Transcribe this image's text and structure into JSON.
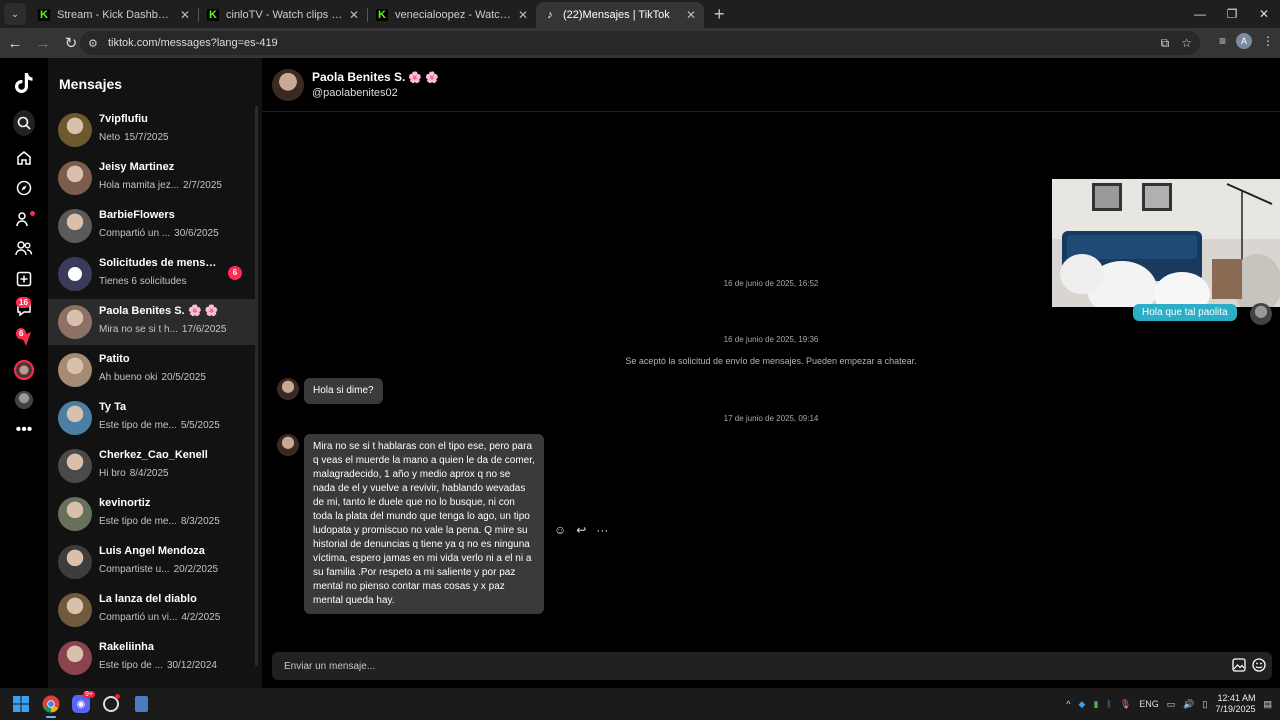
{
  "browser": {
    "tabs": [
      {
        "title": "Stream - Kick Dashboard",
        "favicon": "kick-icon",
        "active": false
      },
      {
        "title": "cinloTV - Watch clips on Kick",
        "favicon": "kick-icon",
        "active": false
      },
      {
        "title": "venecialoopez - Watch clips on",
        "favicon": "kick-icon",
        "active": false
      },
      {
        "title": "(22)Mensajes | TikTok",
        "favicon": "tiktok-icon",
        "active": true
      }
    ],
    "url": "tiktok.com/messages?lang=es-419"
  },
  "rail": {
    "inbox_badge": "16",
    "activity_badge": "6"
  },
  "sidebar": {
    "title": "Mensajes",
    "conversations": [
      {
        "name": "7vipflufiu",
        "preview": "Neto",
        "date": "15/7/2025",
        "avatar_color": "#6b5a2e"
      },
      {
        "name": "Jeisy Martinez",
        "preview": "Hola mamita jez...",
        "date": "2/7/2025",
        "avatar_color": "#7b5c4d"
      },
      {
        "name": "BarbieFlowers",
        "preview": "Compartió un ...",
        "date": "30/6/2025",
        "avatar_color": "#5a5a5a"
      },
      {
        "name": "Solicitudes de mensaj...",
        "preview": "Tienes 6 solicitudes",
        "date": "",
        "avatar_color": "#3a3a5a",
        "badge": "6"
      },
      {
        "name": "Paola Benites S.",
        "flowers": "🌸 🌸",
        "preview": "Mira no se si t h...",
        "date": "17/6/2025",
        "avatar_color": "#8c7164"
      },
      {
        "name": "Patito",
        "preview": "Ah bueno oki",
        "date": "20/5/2025",
        "avatar_color": "#a58a74"
      },
      {
        "name": "Ty Ta",
        "preview": "Este tipo de me...",
        "date": "5/5/2025",
        "avatar_color": "#4c7fa6"
      },
      {
        "name": "Cherkez_Cao_Kenell",
        "preview": "Hi bro",
        "date": "8/4/2025",
        "avatar_color": "#4a4a4a"
      },
      {
        "name": "kevinortiz",
        "preview": "Este tipo de me...",
        "date": "8/3/2025",
        "avatar_color": "#66705a"
      },
      {
        "name": "Luis Angel Mendoza",
        "preview": "Compartiste u...",
        "date": "20/2/2025",
        "avatar_color": "#3d3d3d"
      },
      {
        "name": "La lanza del diablo",
        "preview": "Compartió un vi...",
        "date": "4/2/2025",
        "avatar_color": "#6e5a3c"
      },
      {
        "name": "Rakeliinha",
        "preview": "Este tipo de ...",
        "date": "30/12/2024",
        "avatar_color": "#8a4450"
      }
    ]
  },
  "chat": {
    "name": "Paola Benites S.",
    "flowers": "🌸 🌸",
    "handle": "@paolabenites02",
    "stamp1": "16 de junio de 2025, 16:52",
    "outgoing": "Hola que tal paolita",
    "stamp2": "16 de junio de 2025, 19:36",
    "system": "Se aceptó la solicitud de envío de mensajes. Pueden empezar a chatear.",
    "msg1": "Hola si dime?",
    "stamp3": "17 de junio de 2025, 09:14",
    "msg2": "Mira no se si t hablaras con el tipo ese, pero para q veas el muerde la mano a quien le da de comer, malagradecido, 1 año y medio aprox q no se nada de el y vuelve a revivir, hablando wevadas de mi, tanto le duele que no lo busque, ni con toda la plata del mundo que tenga lo ago, un tipo ludopata y promiscuo no vale la pena. Q mire su historial de denuncias q tiene ya q no es ninguna víctima, espero jamas en mi vida verlo ni a el ni a su familia .Por respeto a mi saliente y por paz mental no pienso contar mas cosas y x paz mental queda hay.",
    "composer_placeholder": "Enviar un mensaje..."
  },
  "taskbar": {
    "lang": "ENG",
    "time": "12:41 AM",
    "date": "7/19/2025",
    "discord_badge": "9+"
  },
  "colors": {
    "accent": "#fe2c55",
    "outgoing_bubble": "#2baec6",
    "incoming_bubble": "#3a3a3a"
  }
}
